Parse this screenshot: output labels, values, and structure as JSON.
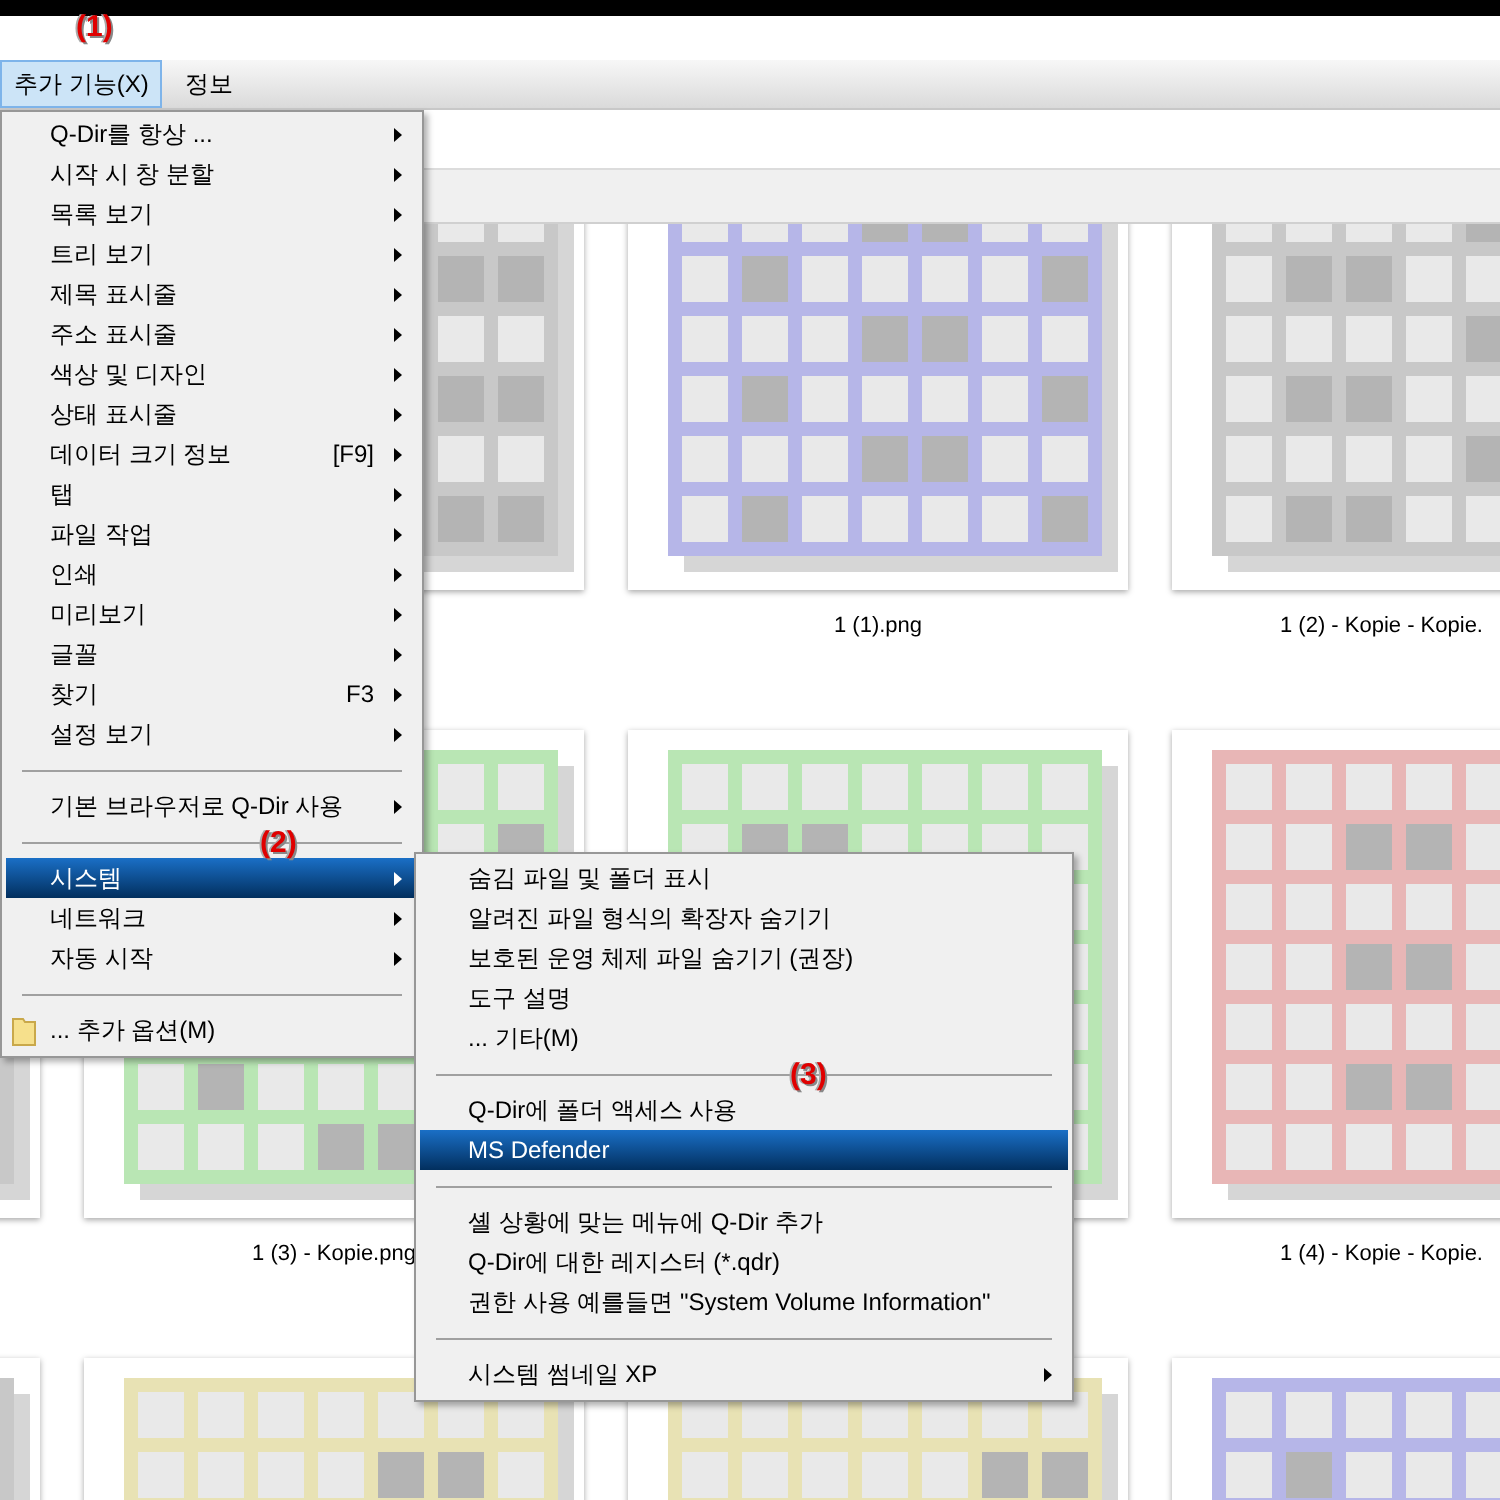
{
  "annotations": [
    {
      "text": "(1)"
    },
    {
      "text": "(2)"
    },
    {
      "text": "(3)"
    }
  ],
  "menubar": [
    {
      "label": "추가 기능(X)",
      "selected": true
    },
    {
      "label": "정보",
      "selected": false
    }
  ],
  "menu": {
    "items": [
      {
        "kind": "item",
        "label": "Q-Dir를 항상 ...",
        "submenu": true,
        "selected": false
      },
      {
        "kind": "item",
        "label": "시작 시 창 분할",
        "submenu": true,
        "selected": false
      },
      {
        "kind": "item",
        "label": "목록 보기",
        "submenu": true,
        "selected": false
      },
      {
        "kind": "item",
        "label": "트리 보기",
        "submenu": true,
        "selected": false
      },
      {
        "kind": "item",
        "label": "제목 표시줄",
        "submenu": true,
        "selected": false
      },
      {
        "kind": "item",
        "label": "주소 표시줄",
        "submenu": true,
        "selected": false
      },
      {
        "kind": "item",
        "label": "색상 및 디자인",
        "submenu": true,
        "selected": false
      },
      {
        "kind": "item",
        "label": "상태 표시줄",
        "submenu": true,
        "selected": false
      },
      {
        "kind": "item",
        "label": "데이터 크기 정보",
        "shortcut": "[F9]",
        "submenu": true,
        "selected": false
      },
      {
        "kind": "item",
        "label": "탭",
        "submenu": true,
        "selected": false
      },
      {
        "kind": "item",
        "label": "파일 작업",
        "submenu": true,
        "selected": false
      },
      {
        "kind": "item",
        "label": "인쇄",
        "submenu": true,
        "selected": false
      },
      {
        "kind": "item",
        "label": "미리보기",
        "submenu": true,
        "selected": false
      },
      {
        "kind": "item",
        "label": "글꼴",
        "submenu": true,
        "selected": false
      },
      {
        "kind": "item",
        "label": "찾기",
        "shortcut": "F3",
        "submenu": true,
        "selected": false
      },
      {
        "kind": "item",
        "label": "설정 보기",
        "submenu": true,
        "selected": false
      },
      {
        "kind": "separator"
      },
      {
        "kind": "item",
        "label": "기본 브라우저로 Q-Dir 사용",
        "submenu": true,
        "selected": false
      },
      {
        "kind": "separator"
      },
      {
        "kind": "item",
        "label": "시스템",
        "submenu": true,
        "selected": true
      },
      {
        "kind": "item",
        "label": "네트워크",
        "submenu": true,
        "selected": false
      },
      {
        "kind": "item",
        "label": "자동 시작",
        "submenu": true,
        "selected": false
      },
      {
        "kind": "separator"
      },
      {
        "kind": "folder_item",
        "label": "... 추가 옵션(M)",
        "submenu": false,
        "selected": false
      }
    ]
  },
  "submenu": {
    "items": [
      {
        "kind": "item",
        "label": "숨김 파일 및 폴더 표시",
        "submenu": false,
        "selected": false
      },
      {
        "kind": "item",
        "label": "알려진 파일 형식의 확장자 숨기기",
        "submenu": false,
        "selected": false
      },
      {
        "kind": "item",
        "label": "보호된 운영 체제 파일 숨기기 (권장)",
        "submenu": false,
        "selected": false
      },
      {
        "kind": "item",
        "label": "도구 설명",
        "submenu": false,
        "selected": false
      },
      {
        "kind": "item",
        "label": "... 기타(M)",
        "submenu": false,
        "selected": false
      },
      {
        "kind": "separator"
      },
      {
        "kind": "item",
        "label": "Q-Dir에 폴더 액세스 사용",
        "submenu": false,
        "selected": false
      },
      {
        "kind": "item",
        "label": "MS Defender",
        "submenu": false,
        "selected": true
      },
      {
        "kind": "separator"
      },
      {
        "kind": "item",
        "label": "셸 상황에 맞는 메뉴에 Q-Dir 추가",
        "submenu": false,
        "selected": false
      },
      {
        "kind": "item",
        "label": "Q-Dir에 대한 레지스터 (*.qdr)",
        "submenu": false,
        "selected": false
      },
      {
        "kind": "item",
        "label": "권한 사용 예를들면 \"System Volume Information\"",
        "submenu": false,
        "selected": false
      },
      {
        "kind": "separator"
      },
      {
        "kind": "item",
        "label": "시스템 썸네일 XP",
        "submenu": true,
        "selected": false
      }
    ]
  },
  "thumbnails": [
    {
      "color": "#c8c8c8"
    },
    {
      "color": "#b6b6e8",
      "label": "1 (1).png"
    },
    {
      "color": "#c8c8c8",
      "label": "1 (2) - Kopie - Kopie."
    },
    {
      "color": "#c8c8c8"
    },
    {
      "color": "#b9e6b4",
      "label": "1 (3) - Kopie.png"
    },
    {
      "color": "#b9e6b4"
    },
    {
      "color": "#e8b6b6",
      "label": "1 (4) - Kopie - Kopie."
    },
    {
      "color": "#c8c8c8"
    },
    {
      "color": "#e8e2b4"
    },
    {
      "color": "#e8e2b4"
    },
    {
      "color": "#b6b6e8"
    }
  ]
}
